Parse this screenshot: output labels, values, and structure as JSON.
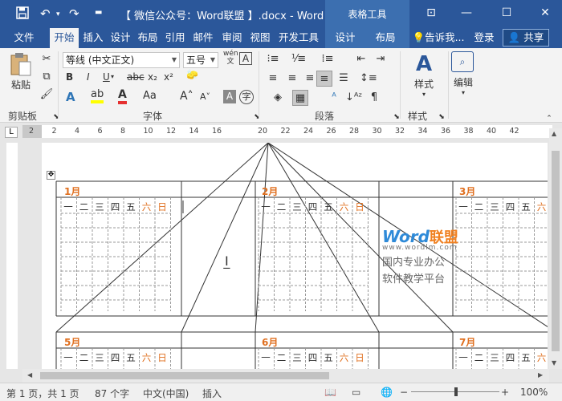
{
  "titlebar": {
    "title": "【 微信公众号：Word联盟 】.docx - Word",
    "context_tab_group": "表格工具",
    "save_icon": "save-icon",
    "undo_icon": "undo-icon",
    "redo_icon": "redo-icon"
  },
  "tabs": {
    "file": "文件",
    "home": "开始",
    "insert": "插入",
    "design": "设计",
    "layout": "布局",
    "references": "引用",
    "mailings": "邮件",
    "review": "审阅",
    "view": "视图",
    "developer": "开发工具",
    "table_design": "设计",
    "table_layout": "布局",
    "tell_me": "告诉我...",
    "sign_in": "登录",
    "share": "共享"
  },
  "ribbon": {
    "paste_label": "粘贴",
    "clipboard_label": "剪贴板",
    "font_name": "等线 (中文正文)",
    "font_size": "五号",
    "font_label": "字体",
    "paragraph_label": "段落",
    "styles_button": "样式",
    "styles_label": "样式",
    "editing_button": "编辑",
    "phonetic": "wén",
    "font_btns": [
      "B",
      "I",
      "U",
      "abc",
      "x₂",
      "x²"
    ],
    "font_btns2": [
      "A",
      "A",
      "Aa",
      "A",
      "A",
      "A",
      "字"
    ]
  },
  "ruler": {
    "h_numbers": [
      "2",
      "2",
      "4",
      "6",
      "8",
      "10",
      "12",
      "14",
      "16",
      "",
      "20",
      "22",
      "24",
      "26",
      "28",
      "30",
      "32",
      "34",
      "36",
      "38",
      "40",
      "42"
    ]
  },
  "calendar": {
    "months_row1": [
      "1月",
      "2月",
      "3月"
    ],
    "months_row2": [
      "5月",
      "6月",
      "7月"
    ],
    "weekdays": [
      "一",
      "二",
      "三",
      "四",
      "五",
      "六",
      "日"
    ]
  },
  "watermark": {
    "logo_word": "Word",
    "logo_cn": "联盟",
    "url": "www.wordlm.com",
    "line1": "国内专业办公",
    "line2": "软件教学平台"
  },
  "statusbar": {
    "page": "第 1 页，共 1 页",
    "words": "87 个字",
    "language": "中文(中国)",
    "mode": "插入",
    "zoom": "100%"
  }
}
